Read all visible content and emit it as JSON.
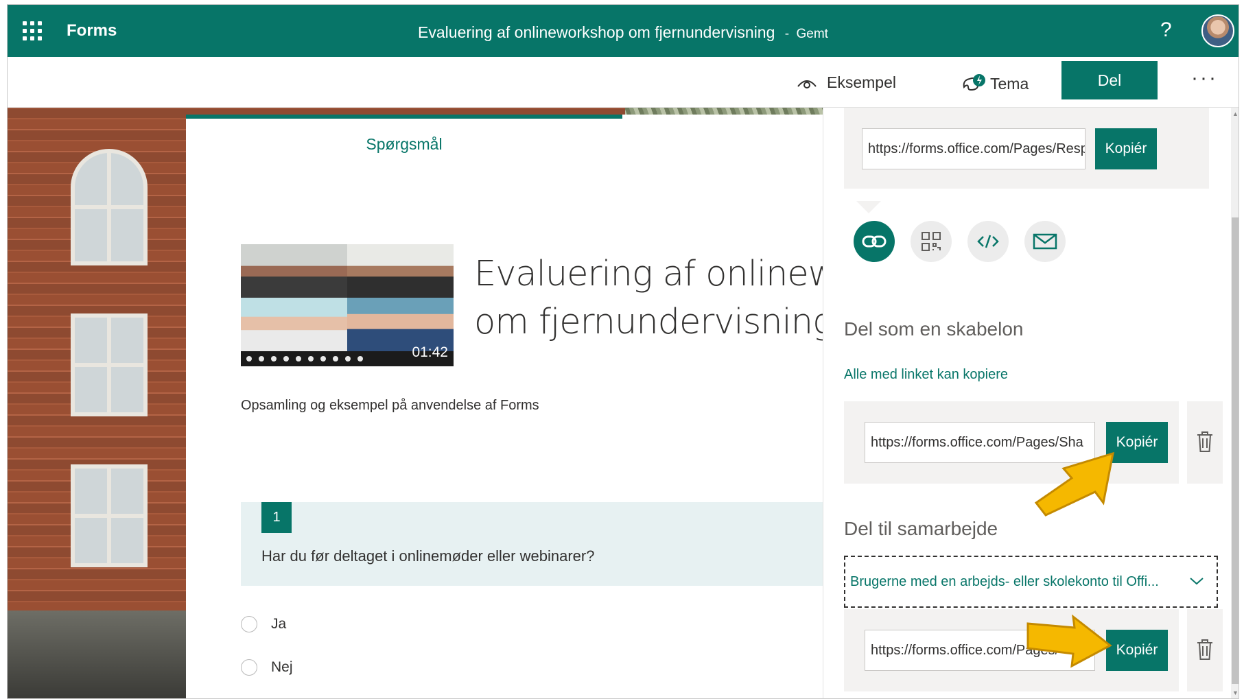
{
  "topbar": {
    "app_name": "Forms",
    "doc_title": "Evaluering af onlineworkshop om fjernundervisning",
    "separator": "-",
    "saved": "Gemt",
    "help": "?"
  },
  "toolbar": {
    "preview_label": "Eksempel",
    "theme_label": "Tema",
    "share_label": "Del",
    "more_label": "···"
  },
  "form": {
    "tab_questions": "Spørgsmål",
    "video_time": "01:42",
    "title_line1": "Evaluering af onlinew",
    "title_line2": "om fjernundervisning",
    "description": "Opsamling og eksempel på anvendelse af Forms",
    "questions": [
      {
        "number": "1",
        "text": "Har du før deltaget i onlinemøder eller webinarer?",
        "options": [
          "Ja",
          "Nej"
        ]
      }
    ]
  },
  "share_panel": {
    "response_url": "https://forms.office.com/Pages/Respon",
    "copy_label": "Kopiér",
    "icons": [
      "link-icon",
      "qr-code-icon",
      "embed-icon",
      "mail-icon"
    ],
    "template_title": "Del som en skabelon",
    "template_link_text": "Alle med linket kan kopiere",
    "template_url": "https://forms.office.com/Pages/Sha",
    "collab_title": "Del til samarbejde",
    "collab_dropdown": "Brugerne med en arbejds- eller skolekonto til Offi...",
    "collab_url": "https://forms.office.com/Pages/"
  },
  "colors": {
    "brand": "#077568",
    "arrow": "#f5b800"
  }
}
